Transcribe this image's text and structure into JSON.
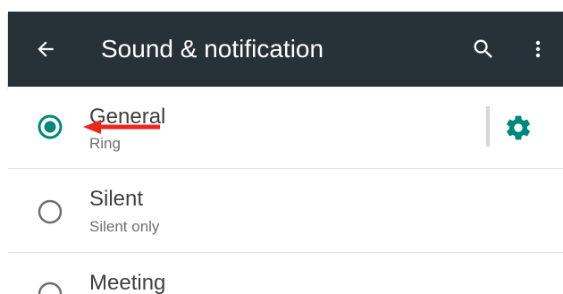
{
  "toolbar": {
    "title": "Sound & notification",
    "back_icon": "arrow-back-icon",
    "search_icon": "search-icon",
    "more_icon": "more-vert-icon",
    "background_color": "#263238"
  },
  "profiles": [
    {
      "label": "General",
      "subtitle": "Ring",
      "selected": true,
      "has_settings": true
    },
    {
      "label": "Silent",
      "subtitle": "Silent only",
      "selected": false,
      "has_settings": false
    },
    {
      "label": "Meeting",
      "subtitle": "",
      "selected": false,
      "has_settings": false
    }
  ],
  "colors": {
    "accent": "#00897b",
    "annotation_arrow": "#e8281f"
  },
  "annotation": {
    "icon": "red-arrow-annotation"
  }
}
